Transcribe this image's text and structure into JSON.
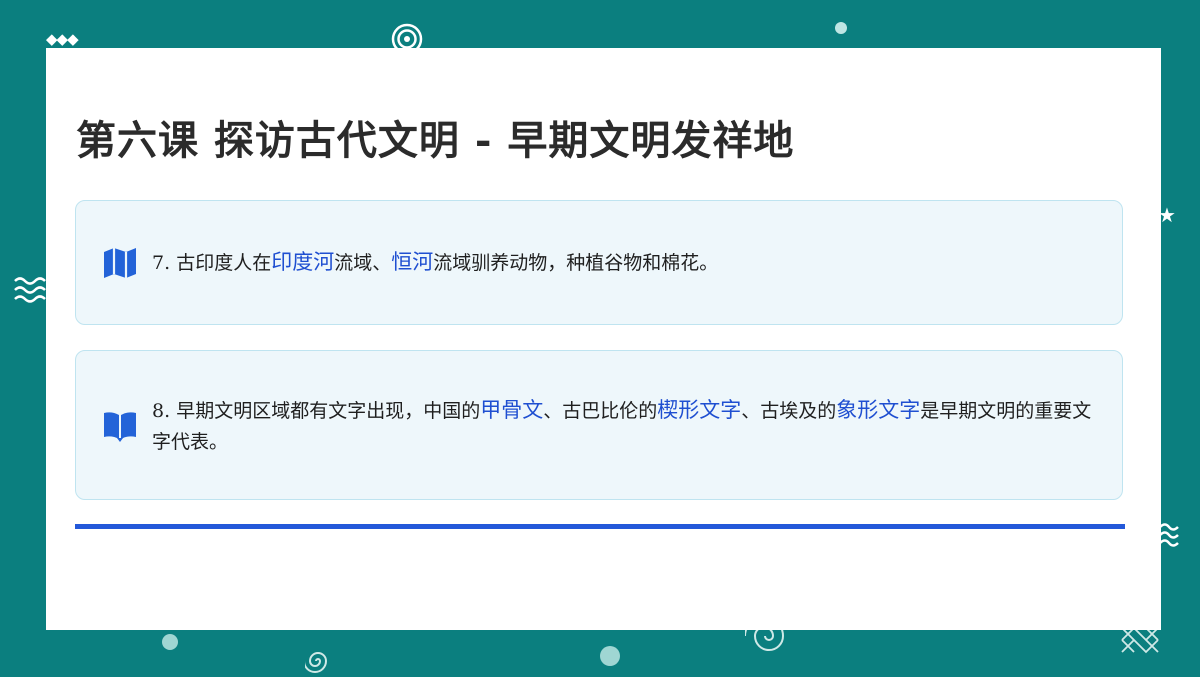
{
  "slide": {
    "title": "第六课 探访古代文明 - 早期文明发祥地",
    "cards": [
      {
        "icon": "map-icon",
        "number": "7.",
        "segments": [
          "古印度人在",
          "印度河",
          "流域、",
          "恒河",
          "流域驯养动物，种植谷物和棉花。"
        ]
      },
      {
        "icon": "open-book-icon",
        "number": "8.",
        "segments": [
          "早期文明区域都有文字出现，中国的",
          "甲骨文",
          "、古巴比伦的",
          "楔形文字",
          "、古埃及的",
          "象形文字",
          "是早期文明的重要文字代表。"
        ]
      }
    ]
  },
  "colors": {
    "background": "#0b7f7f",
    "highlight": "#1f4fd1",
    "divider": "#2358d9",
    "card_bg": "#eef7fb"
  }
}
